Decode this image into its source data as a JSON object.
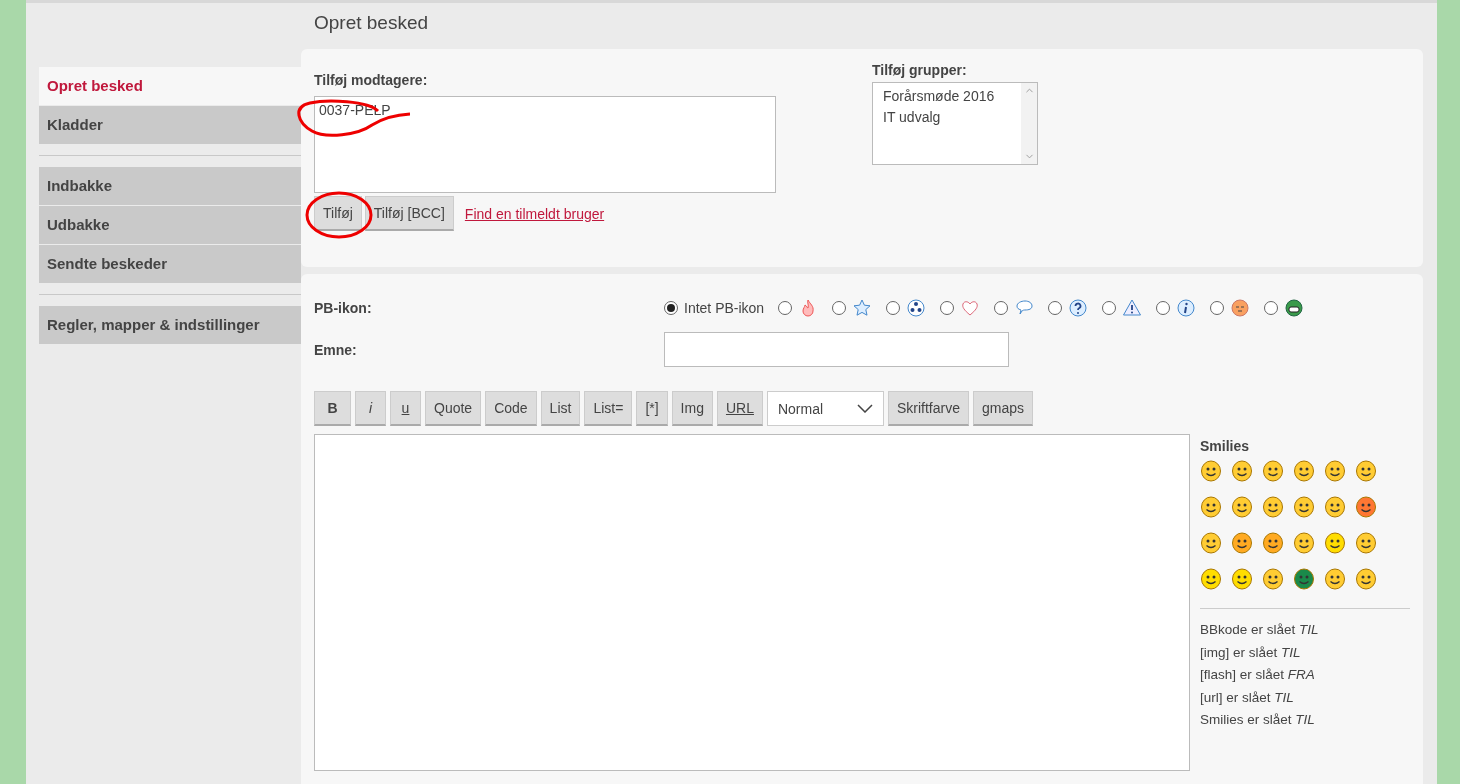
{
  "page_title": "Opret besked",
  "sidebar": {
    "groups": [
      {
        "items": [
          {
            "label": "Opret besked",
            "selected": true
          },
          {
            "label": "Kladder",
            "selected": false
          }
        ]
      },
      {
        "items": [
          {
            "label": "Indbakke",
            "selected": false
          },
          {
            "label": "Udbakke",
            "selected": false
          },
          {
            "label": "Sendte beskeder",
            "selected": false
          }
        ]
      },
      {
        "items": [
          {
            "label": "Regler, mapper & indstillinger",
            "selected": false
          }
        ]
      }
    ]
  },
  "recipients": {
    "label": "Tilføj modtagere:",
    "value": "0037-PELP",
    "buttons": [
      "Tilføj",
      "Tilføj [BCC]"
    ],
    "link": "Find en tilmeldt bruger"
  },
  "groups": {
    "label": "Tilføj grupper:",
    "options": [
      "Forårsmøde 2016",
      "IT udvalg"
    ]
  },
  "pb_icon": {
    "label": "PB-ikon:",
    "options": [
      {
        "kind": "none",
        "label": "Intet PB-ikon",
        "selected": true
      },
      {
        "kind": "flame",
        "selected": false
      },
      {
        "kind": "star",
        "selected": false
      },
      {
        "kind": "radiation",
        "selected": false
      },
      {
        "kind": "heart",
        "selected": false
      },
      {
        "kind": "speech",
        "selected": false
      },
      {
        "kind": "question",
        "selected": false
      },
      {
        "kind": "warning",
        "selected": false
      },
      {
        "kind": "info",
        "selected": false
      },
      {
        "kind": "face",
        "selected": false
      },
      {
        "kind": "grin",
        "selected": false
      }
    ]
  },
  "subject": {
    "label": "Emne:"
  },
  "toolbar": [
    {
      "kind": "bold",
      "label": "B"
    },
    {
      "kind": "italic",
      "label": "i"
    },
    {
      "kind": "underline",
      "label": "u"
    },
    {
      "kind": "button",
      "label": "Quote"
    },
    {
      "kind": "button",
      "label": "Code"
    },
    {
      "kind": "button",
      "label": "List"
    },
    {
      "kind": "button",
      "label": "List="
    },
    {
      "kind": "button",
      "label": "[*]"
    },
    {
      "kind": "button",
      "label": "Img"
    },
    {
      "kind": "underline",
      "label": "URL"
    },
    {
      "kind": "select",
      "label": "Normal"
    },
    {
      "kind": "button",
      "label": "Skriftfarve"
    },
    {
      "kind": "button",
      "label": "gmaps"
    }
  ],
  "smilies": {
    "title": "Smilies"
  },
  "status_lines": [
    "BBkode er slået *TIL*",
    "[img] er slået *TIL*",
    "[flash] er slået *FRA*",
    "[url] er slået *TIL*",
    "Smilies er slået *TIL*"
  ]
}
